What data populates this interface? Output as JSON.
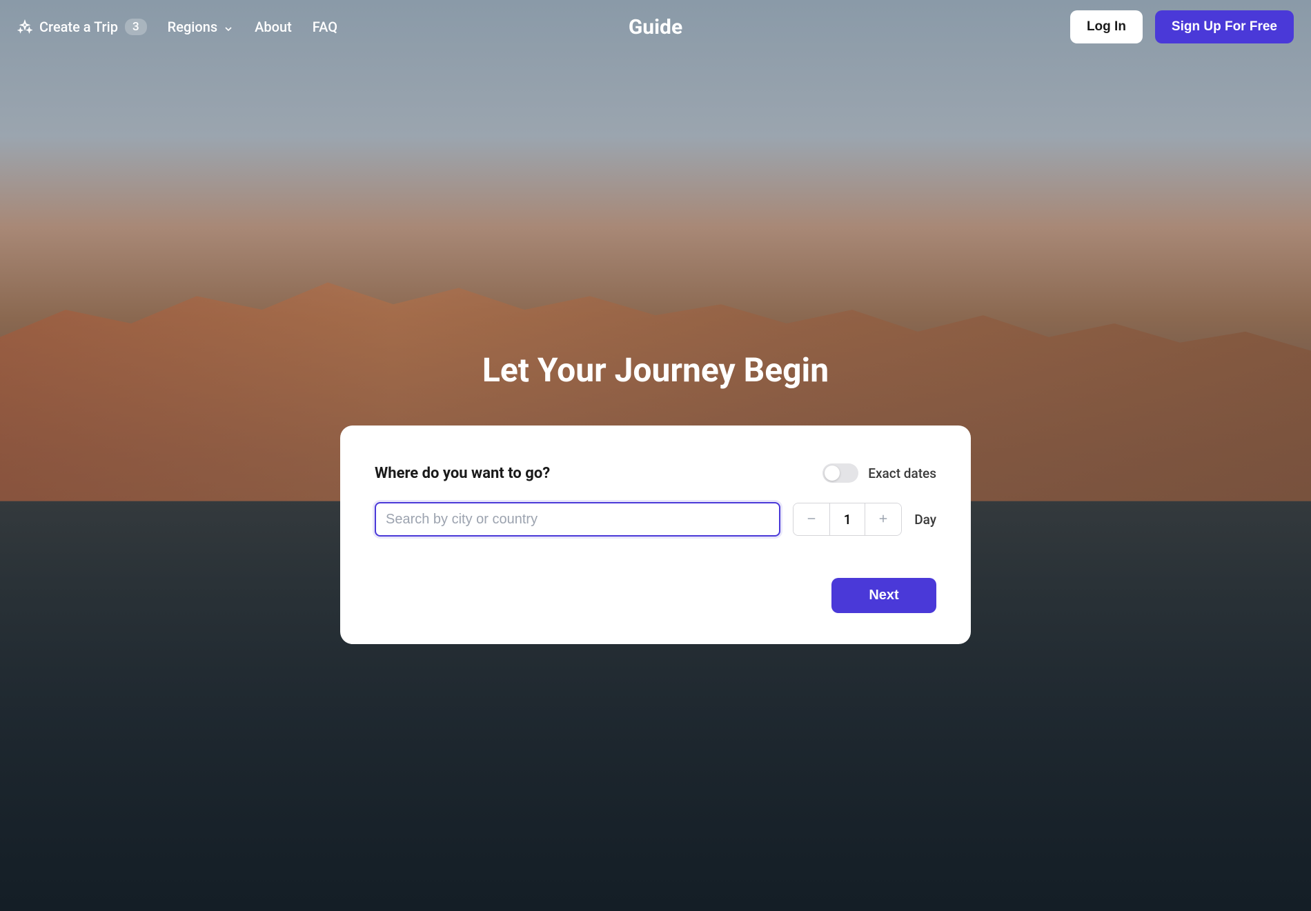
{
  "header": {
    "create_trip_label": "Create a Trip",
    "badge_count": "3",
    "regions_label": "Regions",
    "about_label": "About",
    "faq_label": "FAQ",
    "logo": "Guide",
    "login_label": "Log In",
    "signup_label": "Sign Up For Free"
  },
  "hero": {
    "title": "Let Your Journey Begin"
  },
  "card": {
    "question": "Where do you want to go?",
    "toggle_label": "Exact dates",
    "search_placeholder": "Search by city or country",
    "days_value": "1",
    "day_label": "Day",
    "next_label": "Next"
  }
}
